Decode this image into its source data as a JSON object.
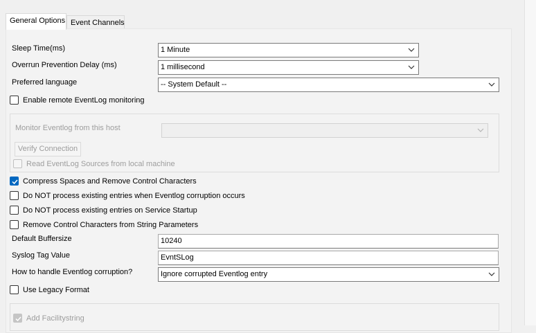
{
  "tabs": [
    {
      "label": "General Options",
      "active": true
    },
    {
      "label": "Event Channels",
      "active": false
    }
  ],
  "sleep_time": {
    "label": "Sleep Time(ms)",
    "value": "1 Minute"
  },
  "overrun_delay": {
    "label": "Overrun Prevention Delay (ms)",
    "value": "1 millisecond"
  },
  "preferred_language": {
    "label": "Preferred language",
    "value": "-- System Default --"
  },
  "enable_remote": {
    "label": "Enable remote EventLog monitoring",
    "checked": false
  },
  "remote_group": {
    "monitor_label": "Monitor Eventlog from this host",
    "monitor_value": "",
    "verify_button": "Verify Connection",
    "read_sources": {
      "label": "Read EventLog Sources from local machine",
      "checked": false,
      "disabled": true
    }
  },
  "compress_spaces": {
    "label": "Compress Spaces and Remove Control Characters",
    "checked": true
  },
  "no_process_corruption": {
    "label": "Do NOT process existing entries when Eventlog corruption occurs",
    "checked": false
  },
  "no_process_startup": {
    "label": "Do NOT process existing entries on Service Startup",
    "checked": false
  },
  "remove_control_chars": {
    "label": "Remove Control Characters from String Parameters",
    "checked": false
  },
  "default_buffersize": {
    "label": "Default Buffersize",
    "value": "10240"
  },
  "syslog_tag": {
    "label": "Syslog Tag Value",
    "value": "EvntSLog"
  },
  "corruption_handling": {
    "label": "How to handle Eventlog corruption?",
    "value": "Ignore corrupted Eventlog entry"
  },
  "legacy_format": {
    "label": "Use Legacy Format",
    "checked": false
  },
  "add_facility": {
    "label": "Add Facilitystring",
    "checked": true,
    "disabled": true
  },
  "colors": {
    "accent": "#0067c0",
    "background": "#f0f0f0",
    "disabled_text": "#9d9d9d"
  }
}
